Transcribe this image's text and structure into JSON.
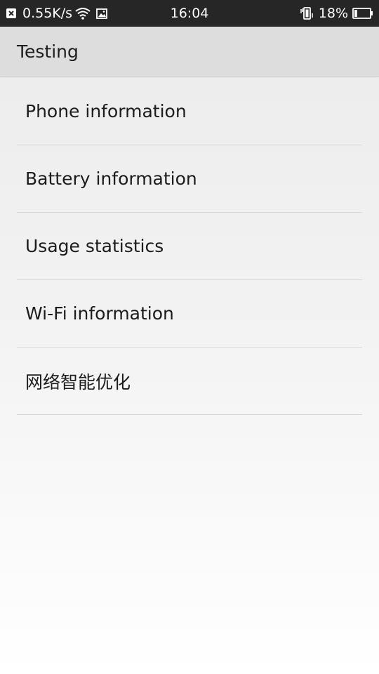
{
  "status_bar": {
    "network_speed": "0.55K/s",
    "time": "16:04",
    "battery_percent": "18%",
    "battery_level": 0.18,
    "icons": [
      "close-notification-icon",
      "wifi-icon",
      "image-icon",
      "vibrate-icon",
      "battery-icon"
    ]
  },
  "header": {
    "title": "Testing"
  },
  "menu": {
    "items": [
      {
        "label": "Phone information"
      },
      {
        "label": "Battery information"
      },
      {
        "label": "Usage statistics"
      },
      {
        "label": "Wi-Fi information"
      },
      {
        "label": "网络智能优化"
      }
    ]
  }
}
